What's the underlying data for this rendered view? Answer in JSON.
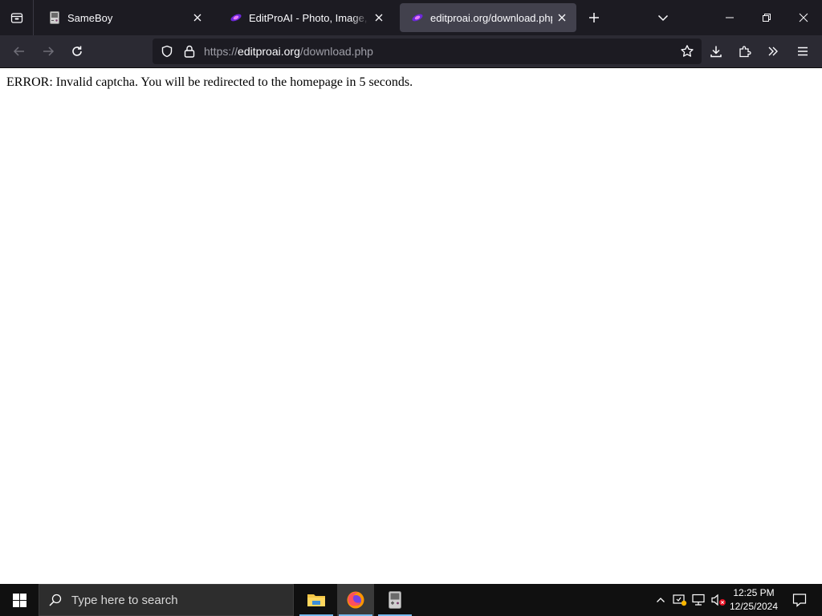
{
  "browser": {
    "tabs": [
      {
        "title": "SameBoy",
        "active": false,
        "favicon": "gameboy-icon"
      },
      {
        "title": "EditProAI - Photo, Image, Video",
        "active": false,
        "favicon": "editproai-icon"
      },
      {
        "title": "editproai.org/download.php",
        "active": true,
        "favicon": "editproai-icon"
      }
    ],
    "url": {
      "scheme": "https://",
      "host": "editproai.org",
      "path": "/download.php"
    }
  },
  "page": {
    "message": "ERROR: Invalid captcha. You will be redirected to the homepage in 5 seconds."
  },
  "taskbar": {
    "search_placeholder": "Type here to search",
    "apps": [
      "file-explorer",
      "firefox",
      "sameboy"
    ],
    "clock": {
      "time": "12:25 PM",
      "date": "12/25/2024"
    }
  },
  "colors": {
    "tabstrip_bg": "#1c1b22",
    "navbar_bg": "#2b2a33",
    "active_tab_bg": "#42414d",
    "taskbar_bg": "#101010",
    "accent_purple": "#9b5cf6"
  }
}
